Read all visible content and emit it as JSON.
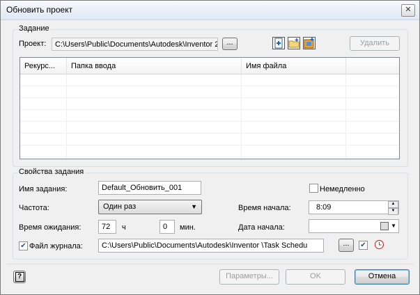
{
  "window": {
    "title": "Обновить проект",
    "close_label": "✕"
  },
  "task": {
    "legend": "Задание",
    "project_label": "Проект:",
    "project_value": "C:\\Users\\Public\\Documents\\Autodesk\\Inventor 2",
    "browse_label": "...",
    "delete_label": "Удалить",
    "columns": [
      "Рекурс...",
      "Папка ввода",
      "Имя файла"
    ]
  },
  "props": {
    "legend": "Свойства задания",
    "task_name_label": "Имя задания:",
    "task_name_value": "Default_Обновить_001",
    "immediately_label": "Немедленно",
    "frequency_label": "Частота:",
    "frequency_value": "Один раз",
    "start_time_label": "Время начала:",
    "start_time_value": "8:09",
    "wait_label": "Время ожидания:",
    "wait_hours": "72",
    "hours_unit": "ч",
    "wait_minutes": "0",
    "minutes_unit": "мин.",
    "start_date_label": "Дата начала:",
    "log_label": "Файл журнала:",
    "log_value": "C:\\Users\\Public\\Documents\\Autodesk\\Inventor            \\Task Schedu",
    "log_browse": "..."
  },
  "footer": {
    "help_label": "?",
    "params_label": "Параметры...",
    "ok_label": "OK",
    "cancel_label": "Отмена"
  }
}
